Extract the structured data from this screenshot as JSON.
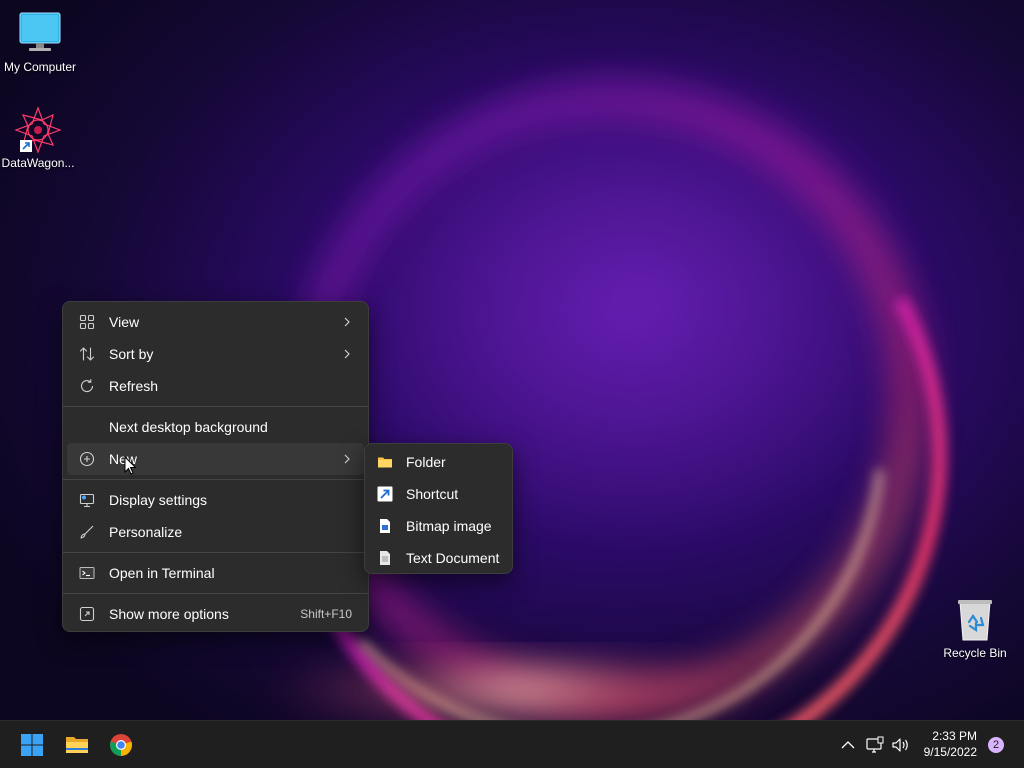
{
  "desktop": {
    "icons": [
      {
        "label": "My Computer",
        "icon": "monitor-icon"
      },
      {
        "label": "DataWagon...",
        "icon": "datawagon-app-icon"
      },
      {
        "label": "Recycle Bin",
        "icon": "recycle-bin-icon"
      }
    ]
  },
  "context_menu": {
    "items": [
      {
        "label": "View",
        "icon": "view-grid-icon",
        "has_submenu": true
      },
      {
        "label": "Sort by",
        "icon": "sort-icon",
        "has_submenu": true
      },
      {
        "label": "Refresh",
        "icon": "refresh-icon"
      },
      {
        "label": "Next desktop background"
      },
      {
        "label": "New",
        "icon": "new-plus-icon",
        "has_submenu": true,
        "highlighted": true
      },
      {
        "label": "Display settings",
        "icon": "display-settings-icon"
      },
      {
        "label": "Personalize",
        "icon": "brush-icon"
      },
      {
        "label": "Open in Terminal",
        "icon": "terminal-icon"
      },
      {
        "label": "Show more options",
        "icon": "more-options-icon",
        "shortcut": "Shift+F10"
      }
    ]
  },
  "new_submenu": {
    "items": [
      {
        "label": "Folder",
        "icon": "folder-icon"
      },
      {
        "label": "Shortcut",
        "icon": "shortcut-icon"
      },
      {
        "label": "Bitmap image",
        "icon": "bitmap-icon"
      },
      {
        "label": "Text Document",
        "icon": "text-document-icon"
      }
    ]
  },
  "taskbar": {
    "pinned": [
      "start-icon",
      "file-explorer-icon",
      "chrome-icon"
    ],
    "tray": [
      "chevron-up-icon",
      "network-icon",
      "volume-icon"
    ],
    "time": "2:33 PM",
    "date": "9/15/2022",
    "notification_count": "2"
  },
  "colors": {
    "menu_bg": "#2c2c2c",
    "menu_hover": "#383838",
    "taskbar_bg": "#1f1f1f",
    "accent_badge": "#d9b3ff"
  }
}
